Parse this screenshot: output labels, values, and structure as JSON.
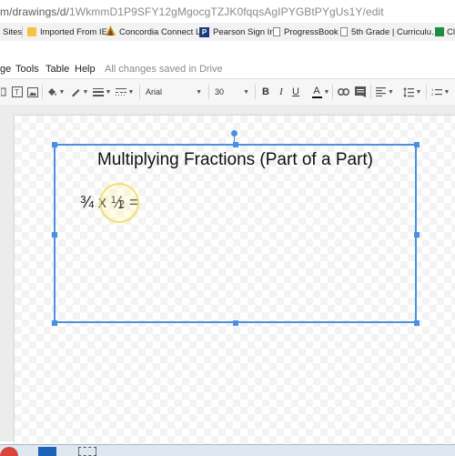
{
  "browser": {
    "url_prefix": "m/drawings/d/",
    "url_rest": "1WkmmD1P9SFY12gMgocgTZJK0fqqsAgIPYGBtPYgUs1Y/edit",
    "bookmarks": [
      {
        "label": "Sites",
        "icon": "apps-icon"
      },
      {
        "label": "Imported From IE",
        "icon": "folder-icon"
      },
      {
        "label": "Concordia Connect L…",
        "icon": "concordia-icon"
      },
      {
        "label": "Pearson Sign In",
        "icon": "pearson-icon"
      },
      {
        "label": "ProgressBook",
        "icon": "page-icon"
      },
      {
        "label": "5th Grade | Curriculu…",
        "icon": "page-icon"
      },
      {
        "label": "Cl",
        "icon": "classroom-icon"
      }
    ]
  },
  "menu": {
    "items": [
      "ge",
      "Tools",
      "Table",
      "Help"
    ],
    "save_status": "All changes saved in Drive"
  },
  "toolbar": {
    "font": "Arial",
    "font_size": "30"
  },
  "drawing": {
    "title": "Multiplying Fractions (Part of a Part)",
    "equation": "¾ x ½ ="
  },
  "colors": {
    "selection": "#4a90e2",
    "cursor_highlight": "#f0dc5a"
  }
}
